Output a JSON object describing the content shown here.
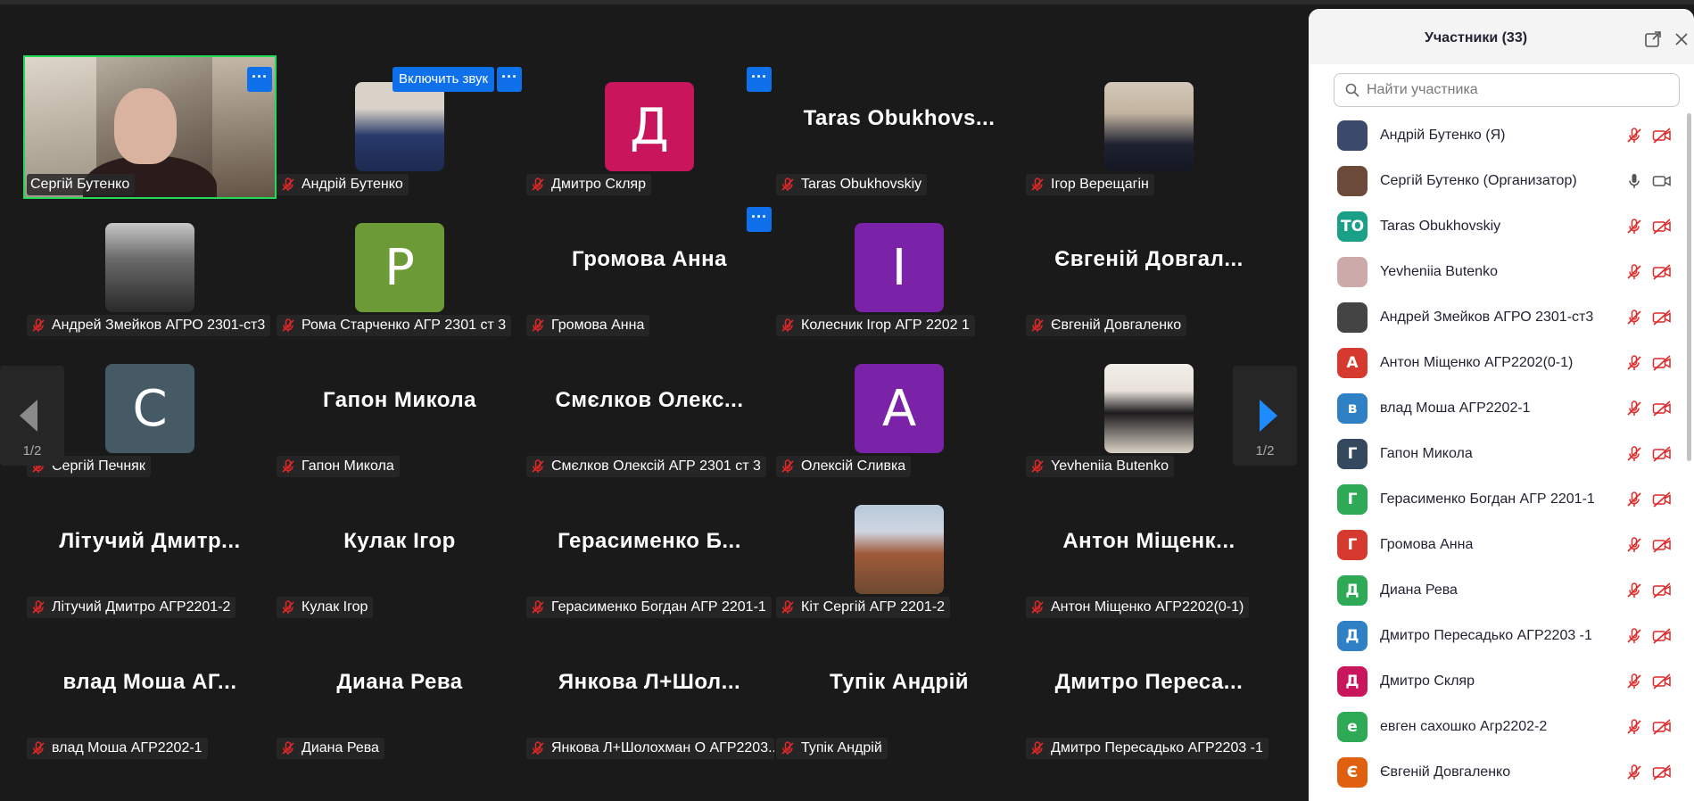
{
  "gallery": {
    "page_label_left": "1/2",
    "page_label_right": "1/2",
    "unmute_label": "Включить звук",
    "more_label": "···",
    "tiles": [
      {
        "big": "",
        "tag": "Сергій Бутенко",
        "avatar_letter": "",
        "muted": false
      },
      {
        "big": "",
        "tag": "Андрій Бутенко",
        "avatar_letter": "",
        "muted": true
      },
      {
        "big": "",
        "tag": "Дмитро Скляр",
        "avatar_letter": "Д",
        "avatar_color": "#c9155b",
        "muted": true
      },
      {
        "big": "Taras  Obukhovs...",
        "tag": "Taras Obukhovskiy",
        "avatar_letter": "",
        "muted": true
      },
      {
        "big": "",
        "tag": "Ігор Верещагін",
        "avatar_letter": "",
        "muted": true
      },
      {
        "big": "",
        "tag": "Андрей Змейков АГРО 2301-ст3",
        "avatar_letter": "",
        "muted": true
      },
      {
        "big": "",
        "tag": "Рома Старченко АГР 2301 ст 3",
        "avatar_letter": "Р",
        "avatar_color": "#6b9a36",
        "muted": true
      },
      {
        "big": "Громова Анна",
        "tag": "Громова Анна",
        "avatar_letter": "",
        "muted": true
      },
      {
        "big": "",
        "tag": "Колесник Ігор АГР 2202 1",
        "avatar_letter": "І",
        "avatar_color": "#7a22a8",
        "muted": true
      },
      {
        "big": "Євгеній  Довгал...",
        "tag": "Євгеній Довгаленко",
        "avatar_letter": "",
        "muted": true
      },
      {
        "big": "",
        "tag": "Сергій Печняк",
        "avatar_letter": "С",
        "avatar_color": "#455a64",
        "muted": true
      },
      {
        "big": "Гапон Микола",
        "tag": "Гапон Микола",
        "avatar_letter": "",
        "muted": true
      },
      {
        "big": "Смєлков  Олекс...",
        "tag": "Смєлков Олексій АГР 2301 ст 3",
        "avatar_letter": "",
        "muted": true
      },
      {
        "big": "",
        "tag": "Олексій Сливка",
        "avatar_letter": "А",
        "avatar_color": "#7a22a8",
        "muted": true
      },
      {
        "big": "",
        "tag": "Yevheniia Butenko",
        "avatar_letter": "",
        "muted": true
      },
      {
        "big": "Літучий  Дмитр...",
        "tag": "Літучий Дмитро АГР2201-2",
        "avatar_letter": "",
        "muted": true
      },
      {
        "big": "Кулак Ігор",
        "tag": "Кулак Ігор",
        "avatar_letter": "",
        "muted": true
      },
      {
        "big": "Герасименко  Б...",
        "tag": "Герасименко Богдан АГР 2201-1",
        "avatar_letter": "",
        "muted": true
      },
      {
        "big": "",
        "tag": "Кіт Сергій АГР 2201-2",
        "avatar_letter": "",
        "muted": true
      },
      {
        "big": "Антон  Міщенк...",
        "tag": "Антон Міщенко АГР2202(0-1)",
        "avatar_letter": "",
        "muted": true
      },
      {
        "big": "влад  Моша  АГ...",
        "tag": "влад Моша АГР2202-1",
        "avatar_letter": "",
        "muted": true
      },
      {
        "big": "Диана Рева",
        "tag": "Диана Рева",
        "avatar_letter": "",
        "muted": true
      },
      {
        "big": "Янкова  Л+Шол...",
        "tag": "Янкова Л+Шолохман О АГР2203...",
        "avatar_letter": "",
        "muted": true
      },
      {
        "big": "Тупік Андрій",
        "tag": "Тупік Андрій",
        "avatar_letter": "",
        "muted": true
      },
      {
        "big": "Дмитро  Переса...",
        "tag": "Дмитро Пересадько АГР2203 -1",
        "avatar_letter": "",
        "muted": true
      }
    ]
  },
  "panel": {
    "title": "Участники (33)",
    "search_placeholder": "Найти участника",
    "participants": [
      {
        "name": "Андрій Бутенко (Я)",
        "initial": "",
        "color": "#3b4a6b",
        "mic": "off",
        "cam": "off"
      },
      {
        "name": "Сергій Бутенко (Организатор)",
        "initial": "",
        "color": "#6b4a3a",
        "mic": "on",
        "cam": "on"
      },
      {
        "name": "Taras Obukhovskiy",
        "initial": "TO",
        "color": "#1aa087",
        "mic": "off",
        "cam": "off"
      },
      {
        "name": "Yevheniia Butenko",
        "initial": "",
        "color": "#caa",
        "mic": "off",
        "cam": "off"
      },
      {
        "name": "Андрей Змейков АГРО 2301-ст3",
        "initial": "",
        "color": "#444",
        "mic": "off",
        "cam": "off"
      },
      {
        "name": "Антон Міщенко АГР2202(0-1)",
        "initial": "А",
        "color": "#d63a2f",
        "mic": "off",
        "cam": "off"
      },
      {
        "name": "влад Моша АГР2202-1",
        "initial": "в",
        "color": "#2f80c4",
        "mic": "off",
        "cam": "off"
      },
      {
        "name": "Гапон Микола",
        "initial": "Г",
        "color": "#34495e",
        "mic": "off",
        "cam": "off"
      },
      {
        "name": "Герасименко Богдан АГР 2201-1",
        "initial": "Г",
        "color": "#2eaa57",
        "mic": "off",
        "cam": "off"
      },
      {
        "name": "Громова Анна",
        "initial": "Г",
        "color": "#d63a2f",
        "mic": "off",
        "cam": "off"
      },
      {
        "name": "Диана Рева",
        "initial": "Д",
        "color": "#2eaa57",
        "mic": "off",
        "cam": "off"
      },
      {
        "name": "Дмитро Пересадько АГР2203 -1",
        "initial": "Д",
        "color": "#2f80c4",
        "mic": "off",
        "cam": "off"
      },
      {
        "name": "Дмитро Скляр",
        "initial": "Д",
        "color": "#c9155b",
        "mic": "off",
        "cam": "off"
      },
      {
        "name": "евген сахошко Агр2202-2",
        "initial": "е",
        "color": "#2eaa57",
        "mic": "off",
        "cam": "off"
      },
      {
        "name": "Євгеній Довгаленко",
        "initial": "Є",
        "color": "#e06010",
        "mic": "off",
        "cam": "off"
      }
    ]
  },
  "colors": {
    "accent": "#0e71eb",
    "active_speaker": "#23d959",
    "mute_red": "#e02828"
  }
}
